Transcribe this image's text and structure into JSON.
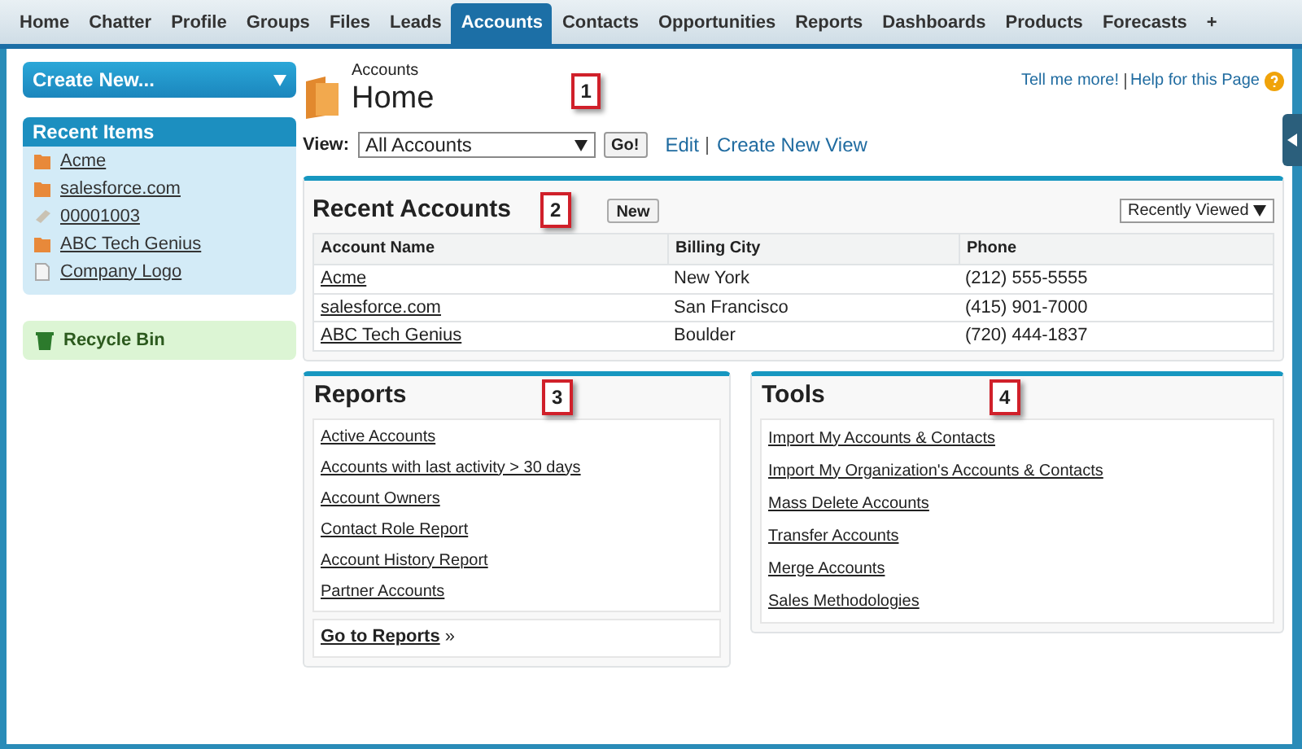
{
  "tabs": [
    {
      "label": "Home",
      "selected": false
    },
    {
      "label": "Chatter",
      "selected": false
    },
    {
      "label": "Profile",
      "selected": false
    },
    {
      "label": "Groups",
      "selected": false
    },
    {
      "label": "Files",
      "selected": false
    },
    {
      "label": "Leads",
      "selected": false
    },
    {
      "label": "Accounts",
      "selected": true
    },
    {
      "label": "Contacts",
      "selected": false
    },
    {
      "label": "Opportunities",
      "selected": false
    },
    {
      "label": "Reports",
      "selected": false
    },
    {
      "label": "Dashboards",
      "selected": false
    },
    {
      "label": "Products",
      "selected": false
    },
    {
      "label": "Forecasts",
      "selected": false
    },
    {
      "label": "+",
      "selected": false
    }
  ],
  "sidebar": {
    "create_button": "Create New...",
    "recent_title": "Recent Items",
    "recent_items": [
      {
        "label": "Acme",
        "kind": "account"
      },
      {
        "label": "salesforce.com",
        "kind": "account"
      },
      {
        "label": "00001003",
        "kind": "case"
      },
      {
        "label": "ABC Tech Genius",
        "kind": "account"
      },
      {
        "label": "Company Logo",
        "kind": "document"
      }
    ],
    "recycle_bin": "Recycle Bin"
  },
  "header": {
    "breadcrumb": "Accounts",
    "title": "Home",
    "callout": "1",
    "help_links": [
      "Tell me more!",
      "Help for this Page"
    ],
    "view_label": "View:",
    "view_value": "All Accounts",
    "go_button": "Go!",
    "edit_link": "Edit",
    "create_view_link": "Create New View"
  },
  "recent_accounts": {
    "title": "Recent Accounts",
    "callout": "2",
    "new_button": "New",
    "filter": "Recently Viewed",
    "columns": [
      "Account Name",
      "Billing City",
      "Phone"
    ],
    "rows": [
      [
        "Acme",
        "New York",
        "(212) 555-5555"
      ],
      [
        "salesforce.com",
        "San Francisco",
        "(415) 901-7000"
      ],
      [
        "ABC Tech Genius",
        "Boulder",
        "(720) 444-1837"
      ]
    ]
  },
  "reports": {
    "title": "Reports",
    "callout": "3",
    "links": [
      "Active Accounts",
      "Accounts with last activity > 30 days",
      "Account Owners",
      "Contact Role Report",
      "Account History Report",
      "Partner Accounts"
    ],
    "footer_link": "Go to Reports",
    "footer_suffix": "»"
  },
  "tools": {
    "title": "Tools",
    "callout": "4",
    "links": [
      "Import My Accounts & Contacts",
      "Import My Organization's Accounts & Contacts",
      "Mass Delete Accounts",
      "Transfer Accounts",
      "Merge Accounts",
      "Sales Methodologies"
    ]
  }
}
